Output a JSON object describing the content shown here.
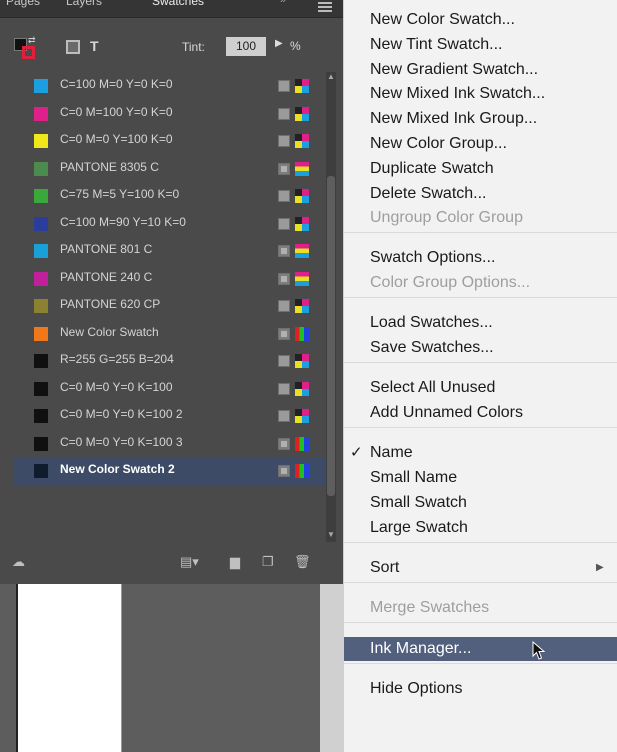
{
  "panel": {
    "tabs": [
      "Pages",
      "Layers",
      "Swatches"
    ],
    "tint_label": "Tint:",
    "tint_value": "100",
    "tint_unit": "%",
    "swatches": [
      {
        "name": "C=100 M=0 Y=0 K=0",
        "color": "#1c9fe0",
        "type": "cmyk"
      },
      {
        "name": "C=0 M=100 Y=0 K=0",
        "color": "#e0208a",
        "type": "cmyk"
      },
      {
        "name": "C=0 M=0 Y=100 K=0",
        "color": "#f0e81a",
        "type": "cmyk"
      },
      {
        "name": "PANTONE 8305 C",
        "color": "#4d8a4d",
        "type": "spot"
      },
      {
        "name": "C=75 M=5 Y=100 K=0",
        "color": "#3aa83a",
        "type": "cmyk"
      },
      {
        "name": "C=100 M=90 Y=10 K=0",
        "color": "#2a3d9a",
        "type": "cmyk"
      },
      {
        "name": "PANTONE 801 C",
        "color": "#1aa0d8",
        "type": "spot"
      },
      {
        "name": "PANTONE 240 C",
        "color": "#c0209a",
        "type": "spot"
      },
      {
        "name": "PANTONE 620 CP",
        "color": "#8a8230",
        "type": "cmyk"
      },
      {
        "name": "New Color Swatch",
        "color": "#f07818",
        "type": "rgb"
      },
      {
        "name": "R=255 G=255 B=204",
        "color": "#101010",
        "type": "cmyk"
      },
      {
        "name": "C=0 M=0 Y=0 K=100",
        "color": "#101010",
        "type": "cmyk"
      },
      {
        "name": "C=0 M=0 Y=0 K=100 2",
        "color": "#101010",
        "type": "cmyk"
      },
      {
        "name": "C=0 M=0 Y=0 K=100 3",
        "color": "#101010",
        "type": "rgb"
      },
      {
        "name": "New Color Swatch 2",
        "color": "#0e1c2e",
        "type": "rgb",
        "selected": true
      }
    ]
  },
  "menu": {
    "items": [
      {
        "label": "New Color Swatch...",
        "enabled": true
      },
      {
        "label": "New Tint Swatch...",
        "enabled": true
      },
      {
        "label": "New Gradient Swatch...",
        "enabled": true
      },
      {
        "label": "New Mixed Ink Swatch...",
        "enabled": true
      },
      {
        "label": "New Mixed Ink Group...",
        "enabled": true
      },
      {
        "label": "New Color Group...",
        "enabled": true
      },
      {
        "label": "Duplicate Swatch",
        "enabled": true
      },
      {
        "label": "Delete Swatch...",
        "enabled": true
      },
      {
        "label": "Ungroup Color Group",
        "enabled": false
      },
      {
        "label": "Swatch Options...",
        "enabled": true
      },
      {
        "label": "Color Group Options...",
        "enabled": false
      },
      {
        "label": "Load Swatches...",
        "enabled": true
      },
      {
        "label": "Save Swatches...",
        "enabled": true
      },
      {
        "label": "Select All Unused",
        "enabled": true
      },
      {
        "label": "Add Unnamed Colors",
        "enabled": true
      },
      {
        "label": "Name",
        "enabled": true,
        "checked": true
      },
      {
        "label": "Small Name",
        "enabled": true
      },
      {
        "label": "Small Swatch",
        "enabled": true
      },
      {
        "label": "Large Swatch",
        "enabled": true
      },
      {
        "label": "Sort",
        "enabled": true,
        "submenu": true
      },
      {
        "label": "Merge Swatches",
        "enabled": false
      },
      {
        "label": "Ink Manager...",
        "enabled": true,
        "highlighted": true
      },
      {
        "label": "Hide Options",
        "enabled": true
      }
    ]
  }
}
